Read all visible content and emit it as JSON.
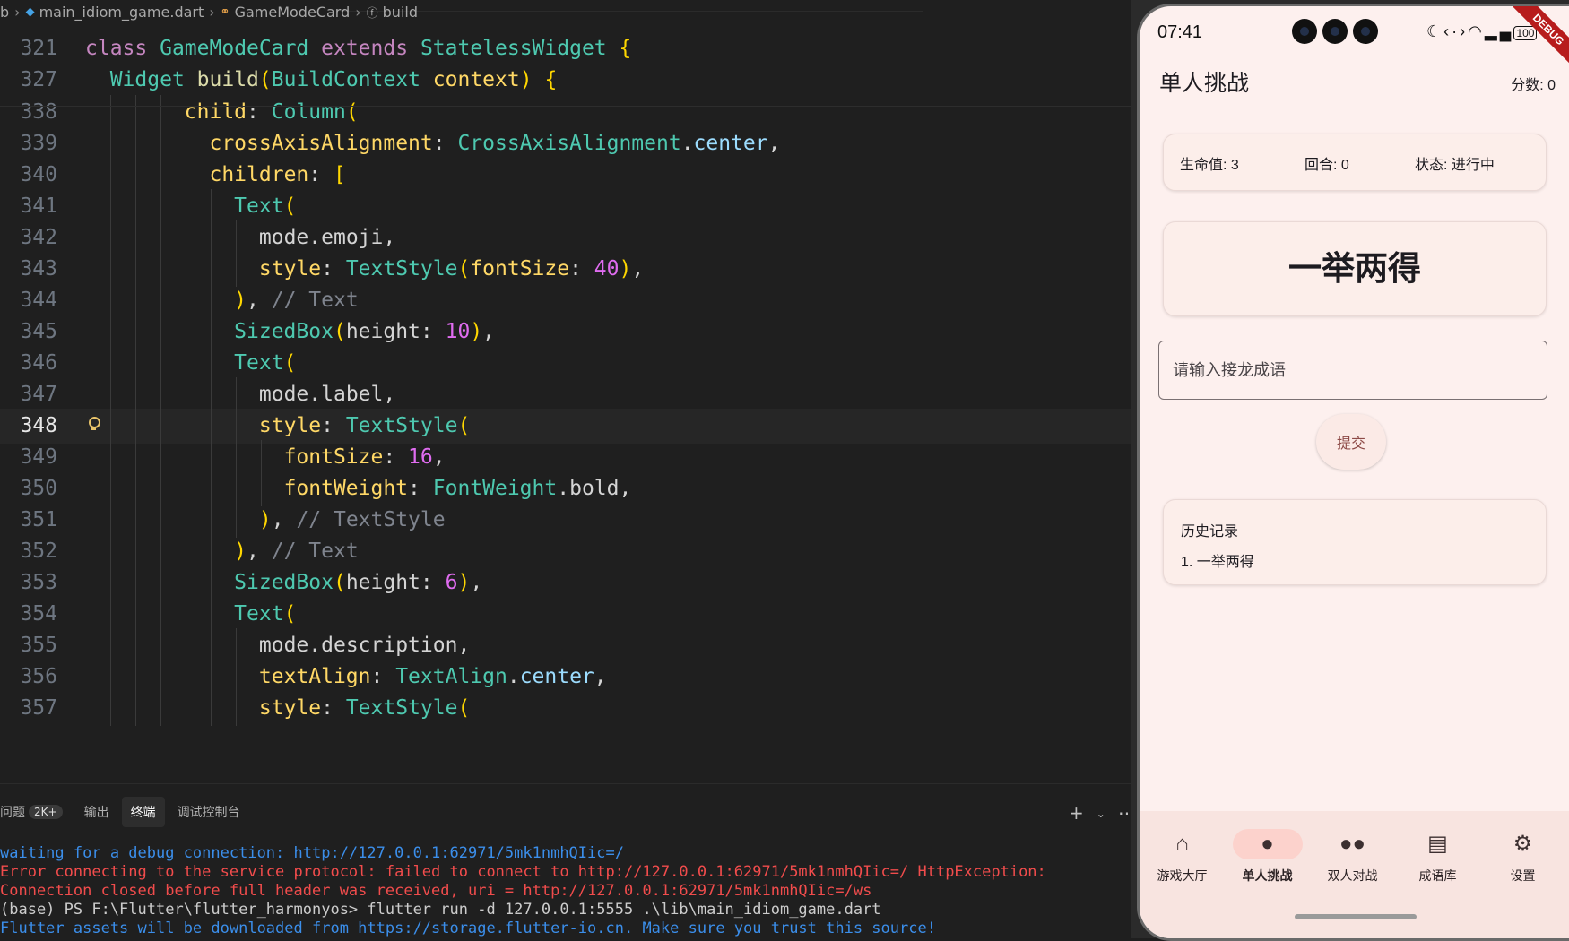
{
  "breadcrumb": [
    {
      "label": "b",
      "icon": ""
    },
    {
      "label": "main_idiom_game.dart",
      "icon": "dart-file-icon"
    },
    {
      "label": "GameModeCard",
      "icon": "class-icon"
    },
    {
      "label": "build",
      "icon": "method-icon"
    }
  ],
  "code_lines": [
    {
      "num": "321",
      "text": "class GameModeCard extends StatelessWidget {"
    },
    {
      "num": "327",
      "text": "  Widget build(BuildContext context) {"
    },
    {
      "num": "338",
      "text": "        child: Column("
    },
    {
      "num": "339",
      "text": "          crossAxisAlignment: CrossAxisAlignment.center,"
    },
    {
      "num": "340",
      "text": "          children: ["
    },
    {
      "num": "341",
      "text": "            Text("
    },
    {
      "num": "342",
      "text": "              mode.emoji,"
    },
    {
      "num": "343",
      "text": "              style: TextStyle(fontSize: 40),"
    },
    {
      "num": "344",
      "text": "            ), // Text"
    },
    {
      "num": "345",
      "text": "            SizedBox(height: 10),"
    },
    {
      "num": "346",
      "text": "            Text("
    },
    {
      "num": "347",
      "text": "              mode.label,"
    },
    {
      "num": "348",
      "text": "              style: TextStyle("
    },
    {
      "num": "349",
      "text": "                fontSize: 16,"
    },
    {
      "num": "350",
      "text": "                fontWeight: FontWeight.bold,"
    },
    {
      "num": "351",
      "text": "              ), // TextStyle"
    },
    {
      "num": "352",
      "text": "            ), // Text"
    },
    {
      "num": "353",
      "text": "            SizedBox(height: 6),"
    },
    {
      "num": "354",
      "text": "            Text("
    },
    {
      "num": "355",
      "text": "              mode.description,"
    },
    {
      "num": "356",
      "text": "              textAlign: TextAlign.center,"
    },
    {
      "num": "357",
      "text": "              style: TextStyle("
    }
  ],
  "active_line": "348",
  "panel": {
    "tabs": [
      {
        "label": "问题",
        "badge": "2K+"
      },
      {
        "label": "输出"
      },
      {
        "label": "终端"
      },
      {
        "label": "调试控制台"
      }
    ],
    "selected_tab": "终端",
    "terminal": [
      {
        "color": "#3b8eea",
        "text": "waiting for a debug connection: http://127.0.0.1:62971/5mk1nmhQIic=/"
      },
      {
        "color": "#f14c4c",
        "text": "Error connecting to the service protocol: failed to connect to http://127.0.0.1:62971/5mk1nmhQIic=/ HttpException:"
      },
      {
        "color": "#f14c4c",
        "text": "Connection closed before full header was received, uri = http://127.0.0.1:62971/5mk1nmhQIic=/ws"
      },
      {
        "color": "#cccccc",
        "text": "(base) PS F:\\Flutter\\flutter_harmonyos> flutter run -d 127.0.0.1:5555 .\\lib\\main_idiom_game.dart"
      },
      {
        "color": "#3b8eea",
        "text": "Flutter assets will be downloaded from https://storage.flutter-io.cn. Make sure you trust this source!"
      }
    ]
  },
  "phone": {
    "time": "07:41",
    "battery": "100",
    "debug_banner": "DEBUG",
    "title": "单人挑战",
    "score": "分数: 0",
    "stats": {
      "lives": "生命值: 3",
      "round": "回合: 0",
      "status": "状态: 进行中"
    },
    "current_idiom": "一举两得",
    "input_placeholder": "请输入接龙成语",
    "submit_label": "提交",
    "history_title": "历史记录",
    "history": [
      "1. 一举两得"
    ],
    "nav": [
      {
        "label": "游戏大厅",
        "icon": "home-icon"
      },
      {
        "label": "单人挑战",
        "icon": "person-icon"
      },
      {
        "label": "双人对战",
        "icon": "people-icon"
      },
      {
        "label": "成语库",
        "icon": "library-icon"
      },
      {
        "label": "设置",
        "icon": "settings-icon"
      }
    ],
    "selected_nav": "单人挑战",
    "colors": {
      "accent": "#fcd2cc",
      "background": "#fdf0ee",
      "submit_text": "#8d4a47"
    }
  }
}
